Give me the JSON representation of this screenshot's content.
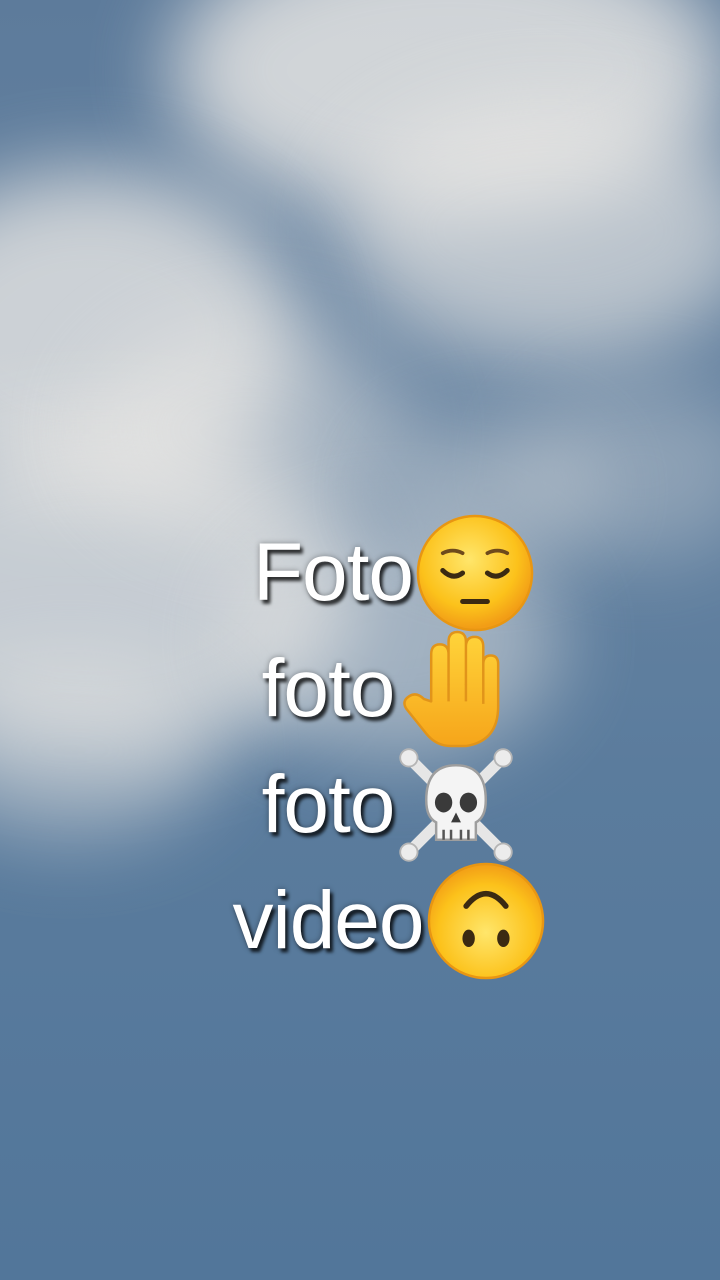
{
  "scene": {
    "background": "cloudy blue sky",
    "sky_color": "#5d7b9b",
    "cloud_color": "#ecebe6"
  },
  "caption": {
    "text_color": "#ffffff",
    "lines": [
      {
        "word": "Foto",
        "emoji": "pensive-face-icon"
      },
      {
        "word": "foto",
        "emoji": "raised-hand-icon"
      },
      {
        "word": "foto",
        "emoji": "skull-and-crossbones-icon"
      },
      {
        "word": "video",
        "emoji": "upside-down-face-icon"
      }
    ]
  }
}
